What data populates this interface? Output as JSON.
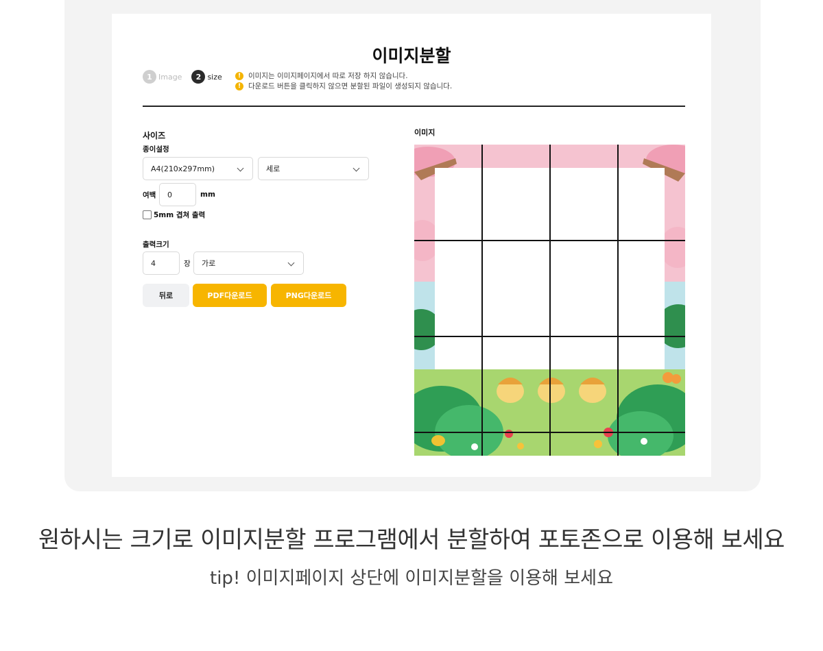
{
  "page_title": "이미지분할",
  "steps": [
    {
      "num": "1",
      "label": "Image"
    },
    {
      "num": "2",
      "label": "size"
    }
  ],
  "notices": [
    "이미지는 이미지페이지에서 따로 저장 하지 않습니다.",
    "다운로드 버튼을 클릭하지 않으면 분할된 파일이 생성되지 않습니다."
  ],
  "form": {
    "size_heading": "사이즈",
    "paper_label": "종이설정",
    "paper_select": "A4(210x297mm)",
    "orientation_select": "세로",
    "margin_label": "여백",
    "margin_value": "0",
    "margin_unit": "mm",
    "overlap_label": "5mm 겹쳐 출력",
    "output_label": "출력크기",
    "output_count": "4",
    "output_unit": "장",
    "output_direction": "가로",
    "back_button": "뒤로",
    "pdf_button": "PDF다운로드",
    "png_button": "PNG다운로드"
  },
  "preview": {
    "label": "이미지",
    "grid_columns": 4,
    "grid_rows": 4
  },
  "captions": {
    "main": "원하시는 크기로 이미지분할 프로그램에서 분할하여 포토존으로 이용해 보세요",
    "tip": "tip! 이미지페이지 상단에 이미지분할을 이용해 보세요"
  },
  "colors": {
    "accent": "#f7b500",
    "warning": "#f4b400"
  }
}
